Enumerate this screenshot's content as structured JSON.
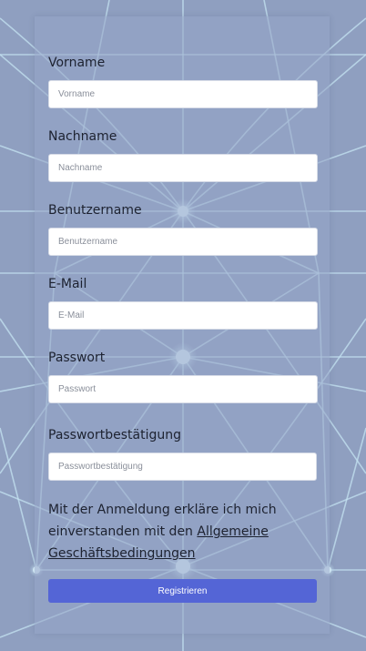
{
  "form": {
    "fields": [
      {
        "label": "Vorname",
        "placeholder": "Vorname"
      },
      {
        "label": "Nachname",
        "placeholder": "Nachname"
      },
      {
        "label": "Benutzername",
        "placeholder": "Benutzername"
      },
      {
        "label": "E-Mail",
        "placeholder": "E-Mail"
      },
      {
        "label": "Passwort",
        "placeholder": "Passwort"
      },
      {
        "label": "Passwortbestätigung",
        "placeholder": "Passwortbestätigung"
      }
    ],
    "terms_text_before": "Mit der Anmeldung erkläre ich mich einverstanden mit den ",
    "terms_link": "Allgemeine Geschäftsbedingungen",
    "submit_label": "Registrieren"
  },
  "colors": {
    "background": "#8f9fc0",
    "card": "#97a5c6",
    "accent": "#5465d6",
    "network_lines": "#c4e3f2"
  }
}
